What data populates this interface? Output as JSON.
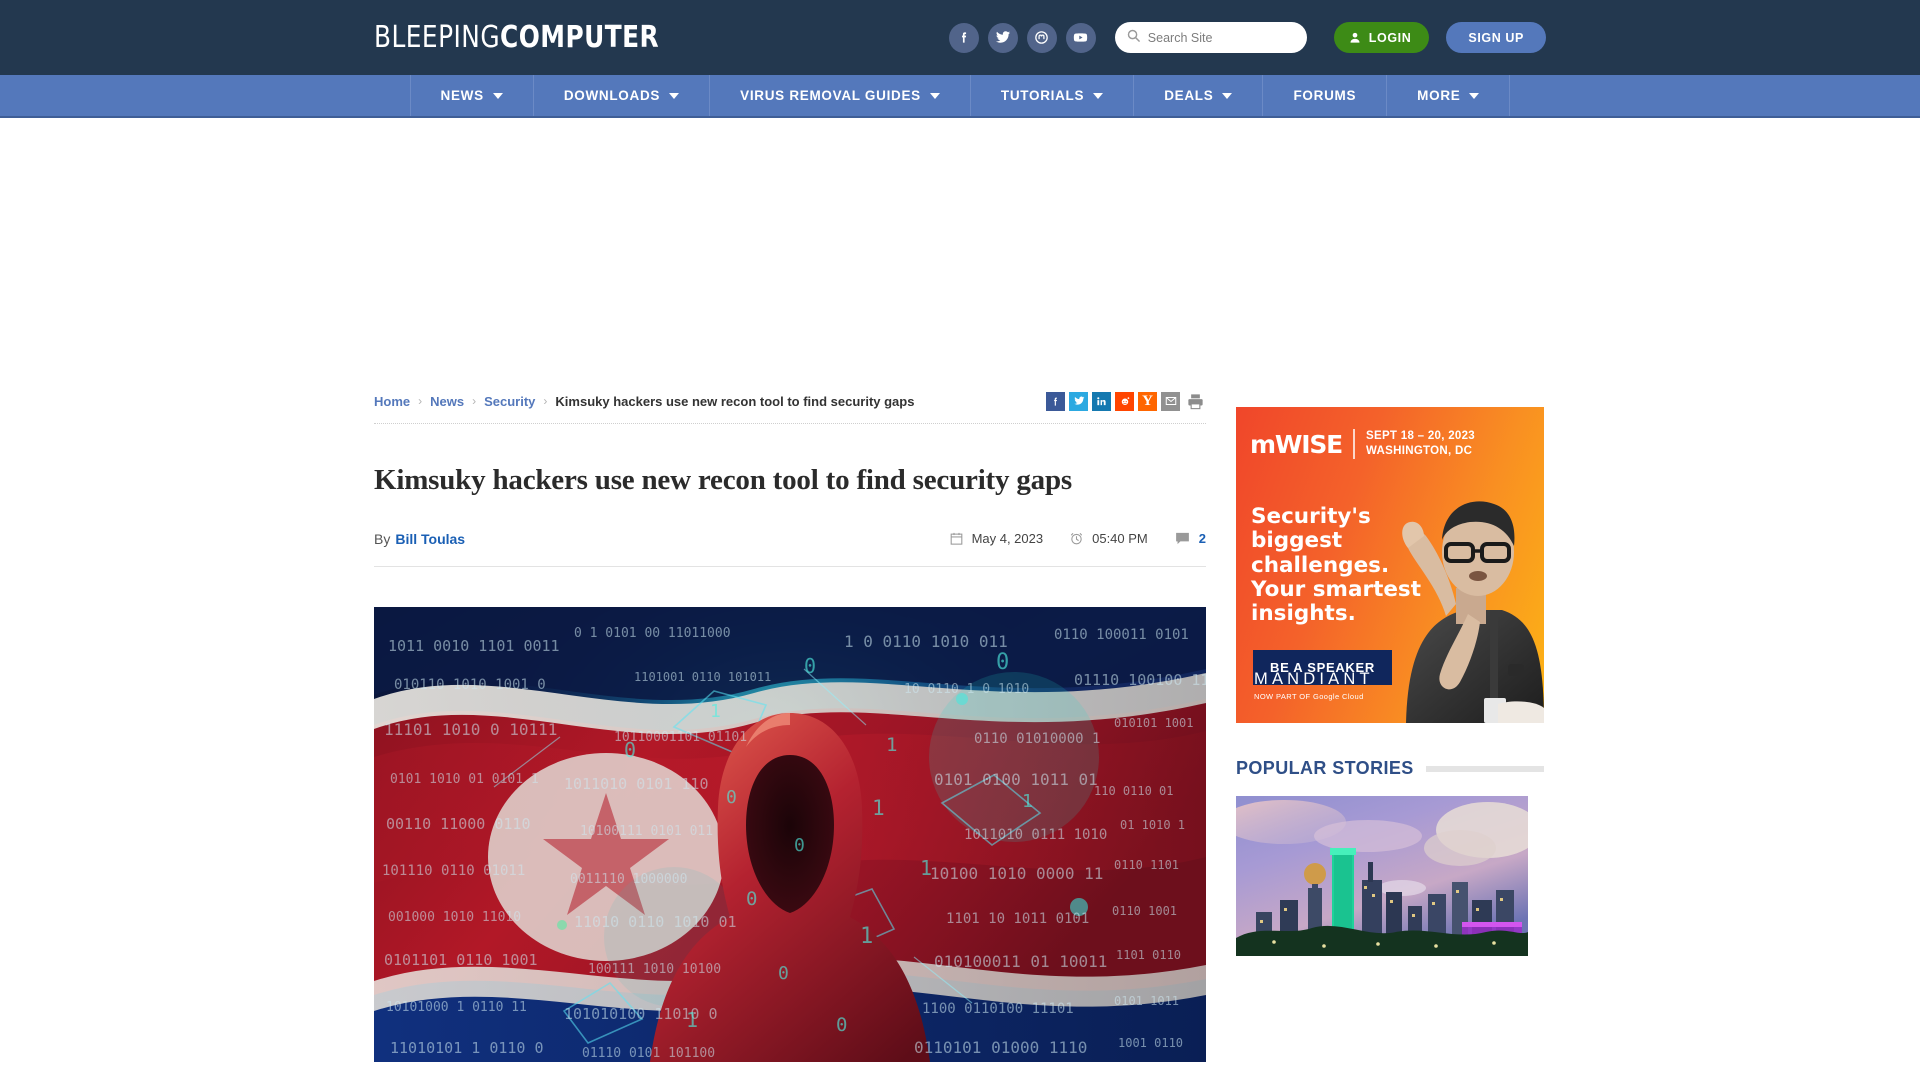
{
  "site": {
    "logo_light": "BLEEPING",
    "logo_bold": "COMPUTER"
  },
  "header": {
    "social": [
      {
        "name": "facebook-icon",
        "label": "Facebook"
      },
      {
        "name": "twitter-icon",
        "label": "Twitter"
      },
      {
        "name": "mastodon-icon",
        "label": "Mastodon"
      },
      {
        "name": "youtube-icon",
        "label": "YouTube"
      }
    ],
    "search": {
      "placeholder": "Search Site",
      "value": "",
      "icon": "search-icon"
    },
    "login_label": "LOGIN",
    "signup_label": "SIGN UP",
    "login_color": "#3d8b16",
    "signup_color": "#5478bb",
    "bar_color": "#23384f"
  },
  "nav": {
    "bar_color": "#5478bb",
    "items": [
      {
        "label": "NEWS",
        "has_caret": true
      },
      {
        "label": "DOWNLOADS",
        "has_caret": true
      },
      {
        "label": "VIRUS REMOVAL GUIDES",
        "has_caret": true
      },
      {
        "label": "TUTORIALS",
        "has_caret": true
      },
      {
        "label": "DEALS",
        "has_caret": true
      },
      {
        "label": "FORUMS",
        "has_caret": false
      },
      {
        "label": "MORE",
        "has_caret": true
      }
    ]
  },
  "breadcrumb": {
    "home": "Home",
    "news": "News",
    "security": "Security",
    "current": "Kimsuky hackers use new recon tool to find security gaps",
    "separator": "›"
  },
  "share": {
    "items": [
      {
        "name": "share-facebook-icon",
        "label": "f",
        "color": "#3b5998"
      },
      {
        "name": "share-twitter-icon",
        "label": "",
        "color": "#2ca9e1"
      },
      {
        "name": "share-linkedin-icon",
        "label": "in",
        "color": "#1579b0"
      },
      {
        "name": "share-reddit-icon",
        "label": "",
        "color": "#ff4500"
      },
      {
        "name": "share-hackernews-icon",
        "label": "Y",
        "color": "#ff6600"
      },
      {
        "name": "share-email-icon",
        "label": "",
        "color": "#919191"
      },
      {
        "name": "share-print-icon",
        "label": "",
        "color": "#8c8c8c"
      }
    ]
  },
  "article": {
    "title": "Kimsuky hackers use new recon tool to find security gaps",
    "by_prefix": "By",
    "author": "Bill Toulas",
    "date": "May 4, 2023",
    "time": "05:40 PM",
    "comment_count": "2",
    "hero_alt": "Hooded figure over North Korean flag with binary code"
  },
  "sidebar": {
    "ad": {
      "brand": "mWISE",
      "date_line1": "SEPT 18 – 20, 2023",
      "date_line2": "WASHINGTON, DC",
      "headline_line1": "Security's biggest",
      "headline_line2": "challenges.",
      "headline_line3": "Your smartest",
      "headline_line4": "insights.",
      "cta": "BE A SPEAKER",
      "sponsor": "MANDIANT",
      "sponsor_sub": "NOW PART OF Google Cloud"
    },
    "popular": {
      "heading": "POPULAR STORIES",
      "thumb_alt": "Dallas city skyline at dusk"
    }
  }
}
